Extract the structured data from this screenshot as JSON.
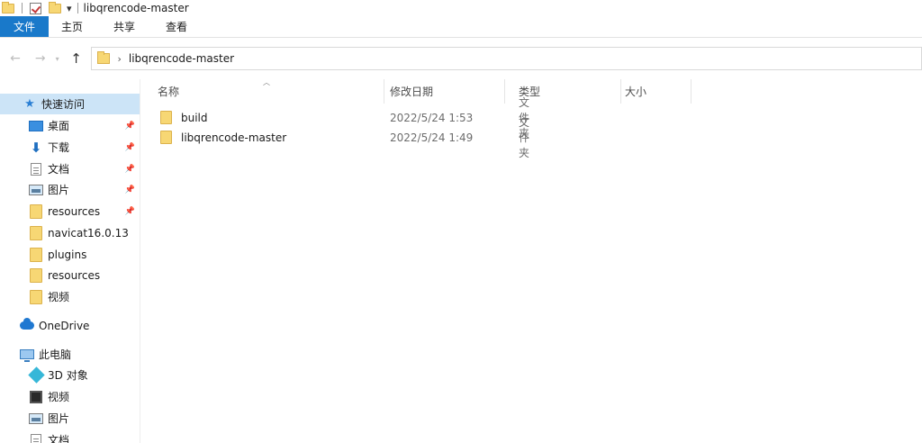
{
  "window": {
    "title": "libqrencode-master"
  },
  "ribbon": {
    "tabs": [
      "文件",
      "主页",
      "共享",
      "查看"
    ]
  },
  "address": {
    "path": "libqrencode-master"
  },
  "sidebar": {
    "items": [
      {
        "label": "快速访问",
        "icon": "star-icon"
      },
      {
        "label": "桌面",
        "icon": "desktop-icon",
        "pinned": true
      },
      {
        "label": "下载",
        "icon": "download-icon",
        "pinned": true
      },
      {
        "label": "文档",
        "icon": "document-icon",
        "pinned": true
      },
      {
        "label": "图片",
        "icon": "pictures-icon",
        "pinned": true
      },
      {
        "label": "resources",
        "icon": "folder-icon",
        "pinned": true
      },
      {
        "label": "navicat16.0.13",
        "icon": "folder-icon"
      },
      {
        "label": "plugins",
        "icon": "folder-icon"
      },
      {
        "label": "resources",
        "icon": "folder-icon"
      },
      {
        "label": "视频",
        "icon": "folder-icon"
      },
      {
        "label": "OneDrive",
        "icon": "cloud-icon"
      },
      {
        "label": "此电脑",
        "icon": "computer-icon"
      },
      {
        "label": "3D 对象",
        "icon": "3d-objects-icon"
      },
      {
        "label": "视频",
        "icon": "video-icon"
      },
      {
        "label": "图片",
        "icon": "pictures-icon"
      },
      {
        "label": "文档",
        "icon": "document-icon"
      }
    ]
  },
  "columns": [
    "名称",
    "修改日期",
    "类型",
    "大小"
  ],
  "files": [
    {
      "name": "build",
      "modified": "2022/5/24 1:53",
      "type": "文件夹"
    },
    {
      "name": "libqrencode-master",
      "modified": "2022/5/24 1:49",
      "type": "文件夹"
    }
  ],
  "colors": {
    "accent": "#1979ca",
    "selection": "#cce4f7",
    "folder": "#f7d774"
  }
}
